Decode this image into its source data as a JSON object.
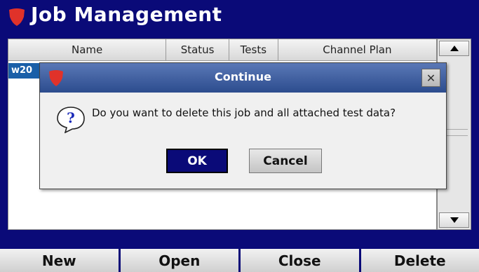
{
  "app": {
    "title": "Job Management",
    "logo_icon": "red-shield-icon"
  },
  "table": {
    "columns": [
      "Name",
      "Status",
      "Tests",
      "Channel Plan"
    ],
    "rows": [
      {
        "name": "w20"
      }
    ]
  },
  "scrollbar": {
    "up_icon": "triangle-up-icon",
    "down_icon": "triangle-down-icon"
  },
  "dialog": {
    "title": "Continue",
    "message": "Do you want to delete this job and all attached test data?",
    "close_label": "✕",
    "ok_label": "OK",
    "cancel_label": "Cancel",
    "icon": "question-icon"
  },
  "function_keys": [
    "New",
    "Open",
    "Close",
    "Delete"
  ],
  "colors": {
    "brand_blue": "#0a0a78",
    "dialog_title": "#3a5a9e",
    "logo_red": "#e0322a",
    "selected_row": "#1a5fa8"
  }
}
